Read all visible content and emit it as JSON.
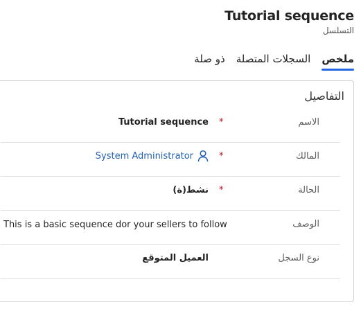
{
  "header": {
    "title": "Tutorial sequence",
    "subtitle": "التسلسل"
  },
  "tabs": [
    {
      "label": "ملخص",
      "active": true
    },
    {
      "label": "السجلات المتصلة",
      "active": false
    },
    {
      "label": "ذو صلة",
      "active": false
    }
  ],
  "details": {
    "section_title": "التفاصيل",
    "name_label": "الاسم",
    "name_value": "Tutorial sequence",
    "owner_label": "المالك",
    "owner_value": "System Administrator",
    "status_label": "الحالة",
    "status_value": "نشط(ة)",
    "description_label": "الوصف",
    "description_value": "This is a basic sequence dor your sellers to follow",
    "record_type_label": "نوع السجل",
    "record_type_value": "العميل المتوقع",
    "required_marker": "*"
  },
  "colors": {
    "accent": "#2266e3",
    "link": "#1f5fb3",
    "required": "#c50f1f"
  },
  "icons": {
    "owner": "person-icon"
  }
}
